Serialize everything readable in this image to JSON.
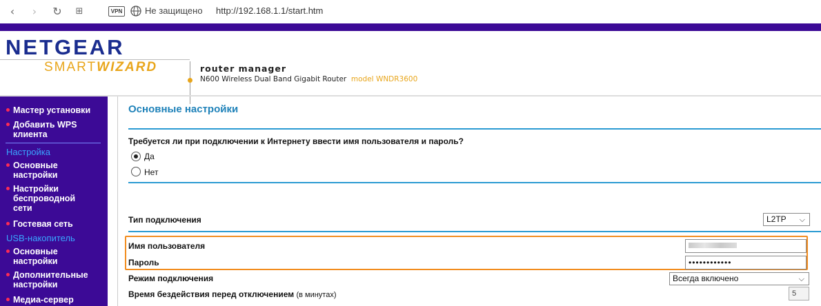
{
  "browser": {
    "vpn_label": "VPN",
    "security_text": "Не защищено",
    "url": "http://192.168.1.1/start.htm"
  },
  "header": {
    "brand": "NETGEAR",
    "smart": "SMART",
    "wizard": "WIZARD",
    "product": "router manager",
    "router_desc": "N600 Wireless Dual Band Gigabit Router",
    "model": "model WNDR3600"
  },
  "sidebar": {
    "items": [
      {
        "label_1": "Мастер установки"
      },
      {
        "label_1": "Добавить WPS",
        "label_2": "клиента"
      }
    ],
    "sections": [
      {
        "title": "Настройка",
        "items": [
          {
            "label_1": "Основные",
            "label_2": "настройки"
          },
          {
            "label_1": "Настройки",
            "label_2": "беспроводной",
            "label_3": "сети"
          },
          {
            "label_1": "Гостевая сеть"
          }
        ]
      },
      {
        "title": "USB-накопитель",
        "items": [
          {
            "label_1": "Основные",
            "label_2": "настройки"
          },
          {
            "label_1": "Дополнительные",
            "label_2": "настройки"
          },
          {
            "label_1": "Медиа-сервер"
          }
        ]
      }
    ]
  },
  "main": {
    "title": "Основные настройки",
    "question": "Требуется ли при подключении к Интернету ввести имя пользователя и пароль?",
    "option_yes": "Да",
    "option_no": "Нет",
    "selected_option": "Да",
    "connection_type_label": "Тип подключения",
    "connection_type_value": "L2TP",
    "username_label": "Имя пользователя",
    "password_label": "Пароль",
    "password_value": "••••••••••••",
    "mode_label": "Режим подключения",
    "mode_value": "Всегда включено",
    "idle_label": "Время бездействия перед отключением",
    "idle_unit": "(в минутах)",
    "idle_value": "5"
  },
  "colors": {
    "purple": "#3c0a96",
    "accent_blue": "#2a9ad2",
    "highlight_orange": "#f28c1e",
    "bullet_red": "#ff2b55"
  }
}
